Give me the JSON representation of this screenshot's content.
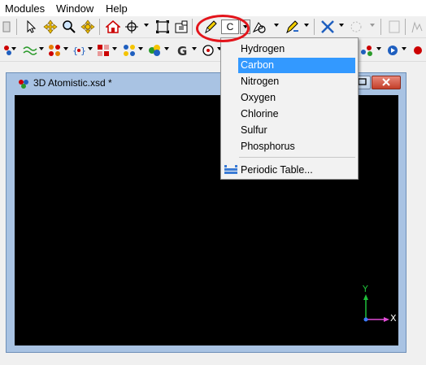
{
  "menubar": {
    "items": [
      "Modules",
      "Window",
      "Help"
    ]
  },
  "toolbar": {
    "element_value": "C"
  },
  "document": {
    "title": "3D Atomistic.xsd *"
  },
  "axes": {
    "y_label": "Y",
    "x_label": "X"
  },
  "element_menu": {
    "items": [
      "Hydrogen",
      "Carbon",
      "Nitrogen",
      "Oxygen",
      "Chlorine",
      "Sulfur",
      "Phosphorus"
    ],
    "selected": "Carbon",
    "periodic_table_label": "Periodic Table..."
  },
  "colors": {
    "highlight": "#3399ff",
    "annotation_circle": "#e3141b",
    "viewport_background": "#000000",
    "window_frame": "#a9c3e3"
  },
  "icons": [
    "select-arrow-icon",
    "translate-icon",
    "zoom-icon",
    "rotate-icon",
    "home-icon",
    "recenter-icon",
    "fit-screen-icon",
    "screenshot-icon",
    "pencil-sketch-icon",
    "sketch-ring-icon",
    "sketch-fragment-icon",
    "build-icon",
    "periodic-table-icon"
  ]
}
